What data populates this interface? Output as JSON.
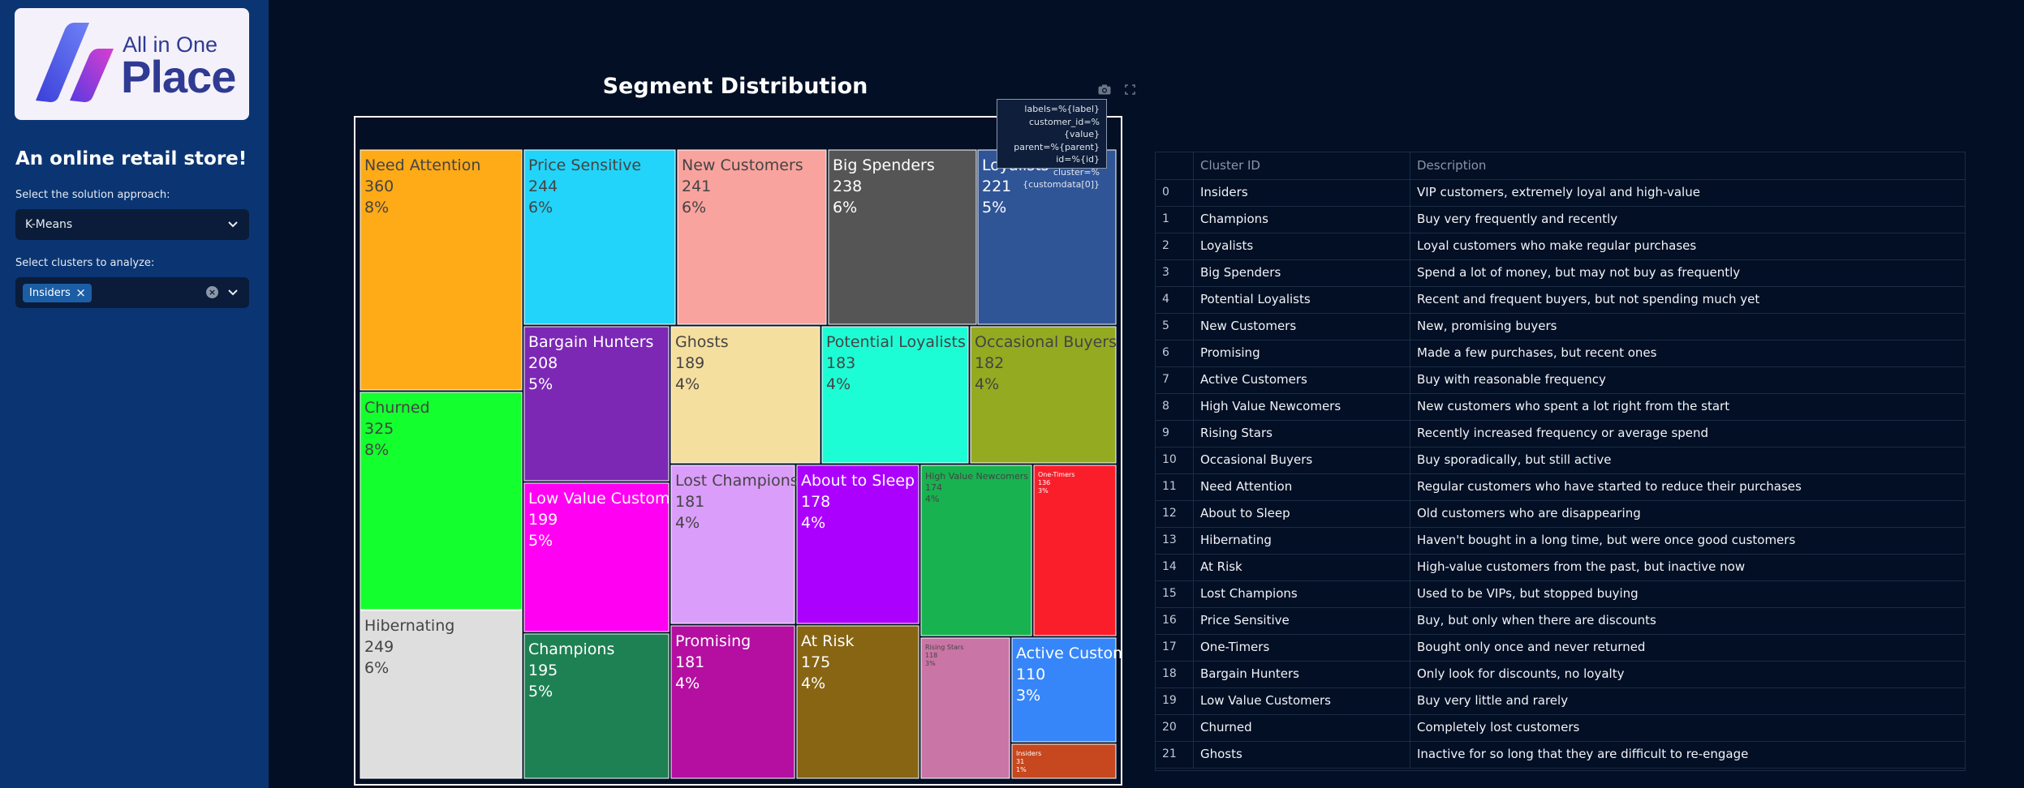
{
  "sidebar": {
    "logo": {
      "line1": "All in One",
      "line2": "Place"
    },
    "title": "An online retail store!",
    "approach_label": "Select the solution approach:",
    "approach_value": "K-Means",
    "clusters_label": "Select clusters to analyze:",
    "selected_clusters": [
      "Insiders"
    ],
    "tag_remove": "×",
    "clear_all": "×"
  },
  "chart": {
    "title": "Segment Distribution",
    "tooltip": [
      "labels=%{label}",
      "customer_id=%{value}",
      "parent=%{parent}",
      "id=%{id}",
      "cluster=%{customdata[0]}"
    ]
  },
  "colors": {
    "page_bg": "#020f24",
    "sidebar_bg": "#0b3572",
    "tag_bg": "#1b5ea6"
  },
  "chart_data": {
    "type": "treemap",
    "title": "Segment Distribution",
    "labels": [
      "Need Attention",
      "Churned",
      "Hibernating",
      "Price Sensitive",
      "New Customers",
      "Big Spenders",
      "Loyalists",
      "Bargain Hunters",
      "Low Value Customers",
      "Champions",
      "Ghosts",
      "Potential Loyalists",
      "Occasional Buyers",
      "Lost Champions",
      "About to Sleep",
      "High Value Newcomers",
      "One-Timers",
      "Promising",
      "At Risk",
      "Rising Stars",
      "Active Customers",
      "Insiders"
    ],
    "values": [
      360,
      325,
      249,
      244,
      241,
      238,
      221,
      208,
      199,
      195,
      189,
      183,
      182,
      181,
      178,
      174,
      136,
      181,
      175,
      118,
      110,
      31
    ],
    "percents": [
      "8%",
      "8%",
      "6%",
      "6%",
      "6%",
      "6%",
      "5%",
      "5%",
      "5%",
      "5%",
      "4%",
      "4%",
      "4%",
      "4%",
      "4%",
      "4%",
      "3%",
      "4%",
      "4%",
      "3%",
      "3%",
      "1%"
    ],
    "colors": [
      "#FFAA17",
      "#14FF2E",
      "#DEDEDE",
      "#22D4FA",
      "#F9A39E",
      "#555555",
      "#2F5597",
      "#7C28B5",
      "#FF00F2",
      "#1E8153",
      "#F5DF9F",
      "#1DFDD5",
      "#94AA21",
      "#DB9DFA",
      "#AB00FE",
      "#18B251",
      "#FA1E2B",
      "#B40FA1",
      "#876513",
      "#C975A5",
      "#3686FA",
      "#C7471E"
    ],
    "text_colors": [
      "#444444",
      "#444444",
      "#444444",
      "#444444",
      "#444444",
      "#ffffff",
      "#ffffff",
      "#ffffff",
      "#ffffff",
      "#ffffff",
      "#444444",
      "#444444",
      "#444444",
      "#444444",
      "#ffffff",
      "#444444",
      "#ffffff",
      "#ffffff",
      "#ffffff",
      "#444444",
      "#ffffff",
      "#ffffff"
    ]
  },
  "table": {
    "columns": [
      "",
      "Cluster ID",
      "Description"
    ],
    "rows": [
      [
        "0",
        "Insiders",
        "VIP customers, extremely loyal and high-value"
      ],
      [
        "1",
        "Champions",
        "Buy very frequently and recently"
      ],
      [
        "2",
        "Loyalists",
        "Loyal customers who make regular purchases"
      ],
      [
        "3",
        "Big Spenders",
        "Spend a lot of money, but may not buy as frequently"
      ],
      [
        "4",
        "Potential Loyalists",
        "Recent and frequent buyers, but not spending much yet"
      ],
      [
        "5",
        "New Customers",
        "New, promising buyers"
      ],
      [
        "6",
        "Promising",
        "Made a few purchases, but recent ones"
      ],
      [
        "7",
        "Active Customers",
        "Buy with reasonable frequency"
      ],
      [
        "8",
        "High Value Newcomers",
        "New customers who spent a lot right from the start"
      ],
      [
        "9",
        "Rising Stars",
        "Recently increased frequency or average spend"
      ],
      [
        "10",
        "Occasional Buyers",
        "Buy sporadically, but still active"
      ],
      [
        "11",
        "Need Attention",
        "Regular customers who have started to reduce their purchases"
      ],
      [
        "12",
        "About to Sleep",
        "Old customers who are disappearing"
      ],
      [
        "13",
        "Hibernating",
        "Haven't bought in a long time, but were once good customers"
      ],
      [
        "14",
        "At Risk",
        "High-value customers from the past, but inactive now"
      ],
      [
        "15",
        "Lost Champions",
        "Used to be VIPs, but stopped buying"
      ],
      [
        "16",
        "Price Sensitive",
        "Buy, but only when there are discounts"
      ],
      [
        "17",
        "One-Timers",
        "Bought only once and never returned"
      ],
      [
        "18",
        "Bargain Hunters",
        "Only look for discounts, no loyalty"
      ],
      [
        "19",
        "Low Value Customers",
        "Buy very little and rarely"
      ],
      [
        "20",
        "Churned",
        "Completely lost customers"
      ],
      [
        "21",
        "Ghosts",
        "Inactive for so long that they are difficult to re-engage"
      ]
    ]
  }
}
